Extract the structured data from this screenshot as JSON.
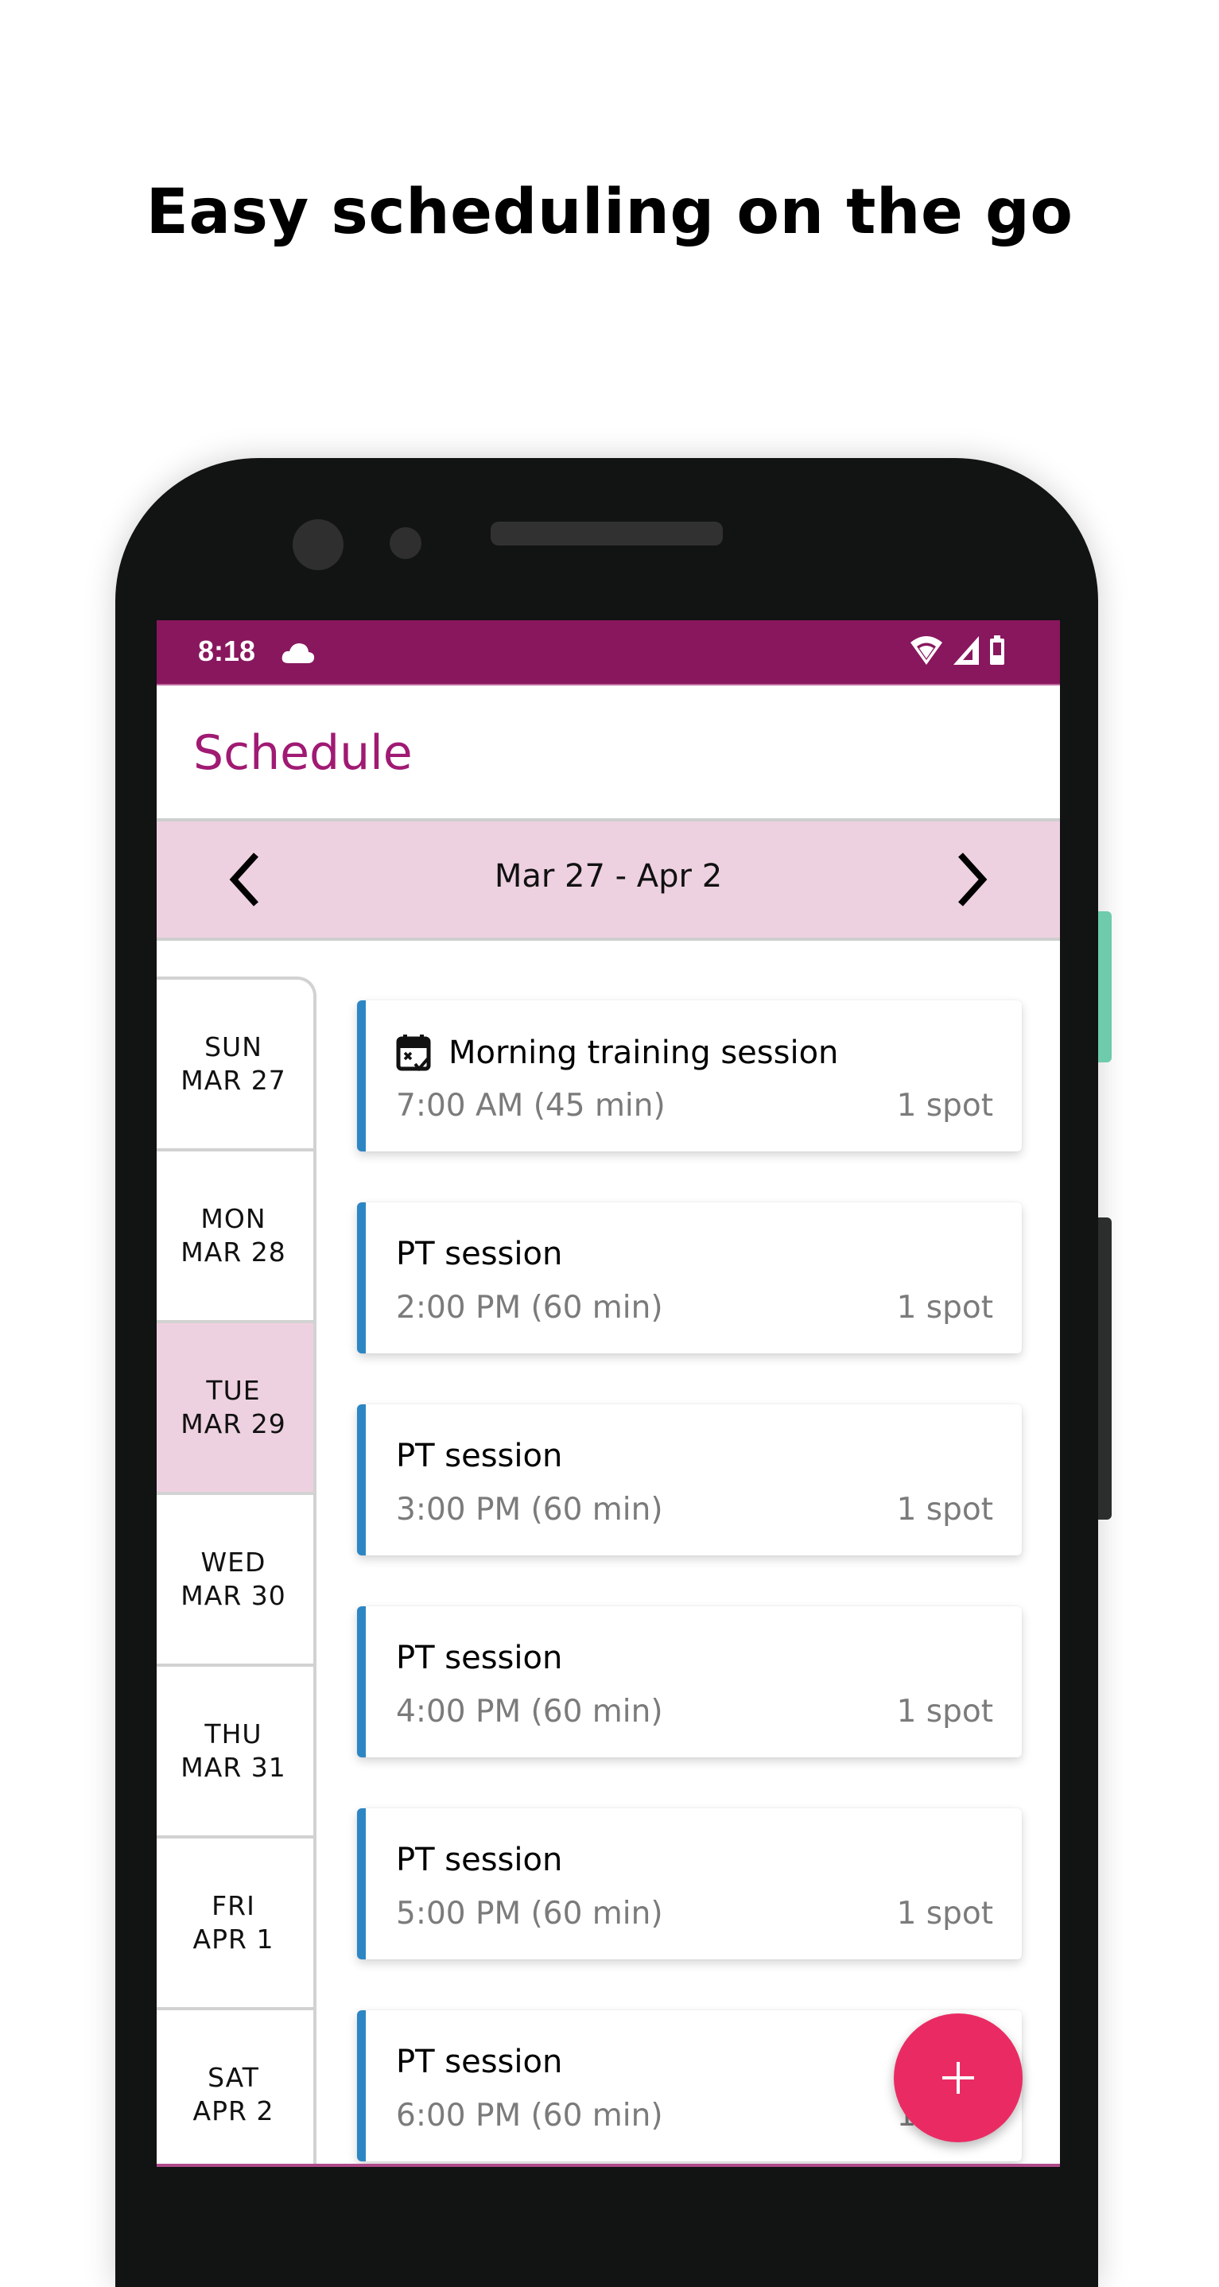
{
  "headline": "Easy scheduling on the go",
  "status_bar": {
    "time": "8:18",
    "icons": [
      "cloud-icon",
      "wifi-icon",
      "cell-signal-icon",
      "battery-icon"
    ]
  },
  "app": {
    "title": "Schedule",
    "week_range": "Mar 27 - Apr 2",
    "nav": {
      "prev_icon": "chevron-left-icon",
      "next_icon": "chevron-right-icon"
    }
  },
  "days": [
    {
      "weekday": "SUN",
      "date": "MAR 27",
      "selected": false
    },
    {
      "weekday": "MON",
      "date": "MAR 28",
      "selected": false
    },
    {
      "weekday": "TUE",
      "date": "MAR 29",
      "selected": true
    },
    {
      "weekday": "WED",
      "date": "MAR 30",
      "selected": false
    },
    {
      "weekday": "THU",
      "date": "MAR 31",
      "selected": false
    },
    {
      "weekday": "FRI",
      "date": "APR 1",
      "selected": false
    },
    {
      "weekday": "SAT",
      "date": "APR 2",
      "selected": false
    }
  ],
  "sessions": [
    {
      "title": "Morning training session",
      "icon": "calendar-check-icon",
      "time": "7:00 AM (45 min)",
      "spots": "1 spot"
    },
    {
      "title": "PT session",
      "time": "2:00 PM (60 min)",
      "spots": "1 spot"
    },
    {
      "title": "PT session",
      "time": "3:00 PM (60 min)",
      "spots": "1 spot"
    },
    {
      "title": "PT session",
      "time": "4:00 PM (60 min)",
      "spots": "1 spot"
    },
    {
      "title": "PT session",
      "time": "5:00 PM (60 min)",
      "spots": "1 spot"
    },
    {
      "title": "PT session",
      "time": "6:00 PM (60 min)",
      "spots": "1 spot"
    }
  ],
  "fab": {
    "icon": "plus-icon",
    "label": "+"
  },
  "colors": {
    "brand": "#88175e",
    "title": "#a01a73",
    "highlight": "#eed1e0",
    "card_accent": "#2d86c4",
    "fab": "#ea2b63"
  }
}
